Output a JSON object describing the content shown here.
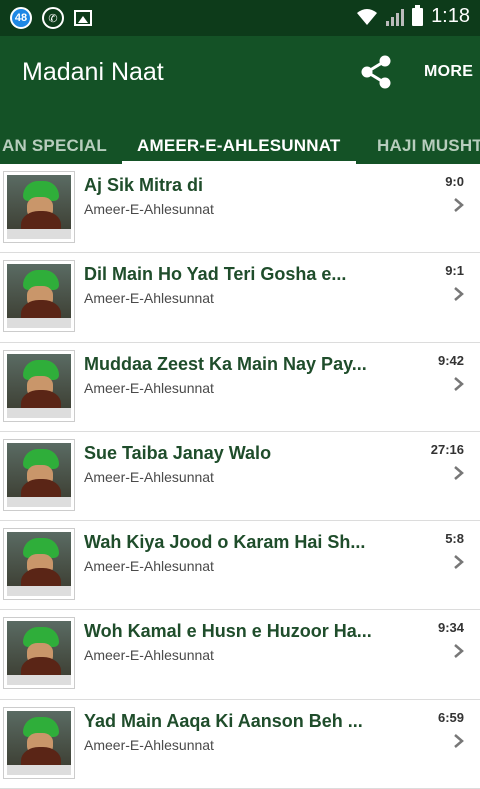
{
  "status_bar": {
    "notification_count": "48",
    "time": "1:18"
  },
  "app_bar": {
    "title": "Madani Naat",
    "more_label": "MORE"
  },
  "tabs": [
    {
      "label": "AN SPECIAL",
      "active": false
    },
    {
      "label": "AMEER-E-AHLESUNNAT",
      "active": true
    },
    {
      "label": "HAJI MUSHT",
      "active": false
    }
  ],
  "items": [
    {
      "title": "Aj Sik Mitra di",
      "subtitle": "Ameer-E-Ahlesunnat",
      "duration": "9:0"
    },
    {
      "title": "Dil Main Ho Yad Teri Gosha e...",
      "subtitle": "Ameer-E-Ahlesunnat",
      "duration": "9:1"
    },
    {
      "title": "Muddaa Zeest Ka Main Nay Pay...",
      "subtitle": "Ameer-E-Ahlesunnat",
      "duration": "9:42"
    },
    {
      "title": "Sue Taiba Janay Walo",
      "subtitle": "Ameer-E-Ahlesunnat",
      "duration": "27:16"
    },
    {
      "title": "Wah Kiya Jood o Karam Hai Sh...",
      "subtitle": "Ameer-E-Ahlesunnat",
      "duration": "5:8"
    },
    {
      "title": "Woh Kamal e Husn e Huzoor Ha...",
      "subtitle": "Ameer-E-Ahlesunnat",
      "duration": "9:34"
    },
    {
      "title": "Yad Main Aaqa Ki Aanson Beh ...",
      "subtitle": "Ameer-E-Ahlesunnat",
      "duration": "6:59"
    }
  ],
  "colors": {
    "app_bar": "#145226",
    "status_bar": "#0d3b1a",
    "title_text": "#1f4d2b"
  }
}
